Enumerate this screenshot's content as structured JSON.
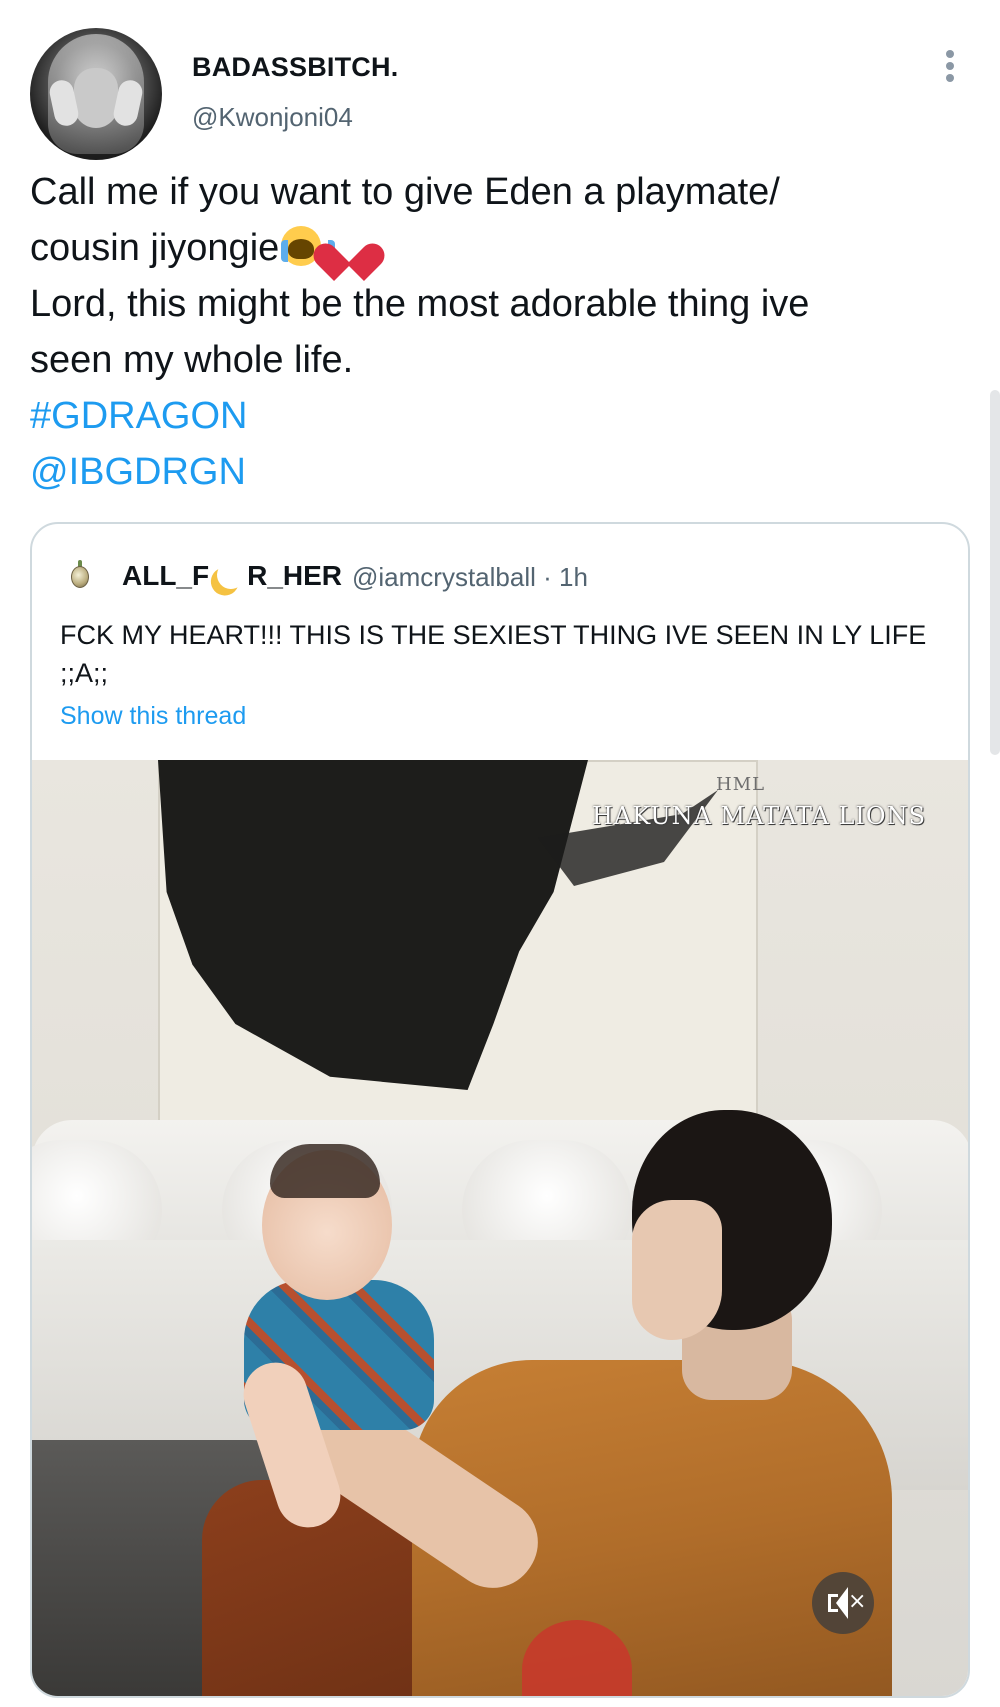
{
  "tweet": {
    "display_name": "BADASSBITCH.",
    "handle": "@Kwonjoni04",
    "lines": [
      "Call me if you want to give Eden a playmate/",
      "cousin jiyongie",
      "Lord, this might be the most adorable thing ive",
      "seen my whole life."
    ],
    "hashtag": "#GDRAGON",
    "mention": "@IBGDRGN",
    "emojis": [
      "crying-face-icon",
      "red-heart-icon"
    ],
    "link_color": "#1d9bf0"
  },
  "quoted": {
    "name_part1": "ALL_F",
    "name_part2": "R_HER",
    "handle": "@iamcrystalball",
    "time": "· 1h",
    "text": "FCK MY HEART!!! THIS IS THE SEXIEST THING IVE SEEN IN LY LIFE ;;A;;",
    "show_thread": "Show this thread",
    "media": {
      "watermark_small": "HML",
      "watermark": "HAKUNA MATATA LIONS",
      "mute_icon": "speaker-muted-icon",
      "mute_label": "×"
    }
  }
}
